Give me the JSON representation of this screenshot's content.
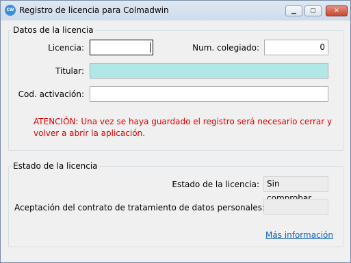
{
  "window": {
    "title": "Registro de licencia para Colmadwin",
    "icon": "cw-app-icon"
  },
  "license_data": {
    "group_title": "Datos de la licencia",
    "licencia_label": "Licencia:",
    "licencia_value": "",
    "num_colegiado_label": "Num. colegiado:",
    "num_colegiado_value": "0",
    "titular_label": "Titular:",
    "titular_value": "",
    "cod_activacion_label": "Cod. activación:",
    "cod_activacion_value": "",
    "warning": "ATENCIÓN: Una vez se haya guardado el registro será necesario cerrar y volver a abrir la aplicación."
  },
  "license_status": {
    "group_title": "Estado de la licencia",
    "estado_label": "Estado de la licencia:",
    "estado_value": "Sin comprobar",
    "aceptacion_label": "Aceptación del contrato de tratamiento de datos personales:",
    "aceptacion_value": "",
    "more_info_link": "Más información"
  },
  "colors": {
    "warning": "#e00000",
    "titular_background": "#b0e8e8",
    "link": "#0b5fbe"
  }
}
